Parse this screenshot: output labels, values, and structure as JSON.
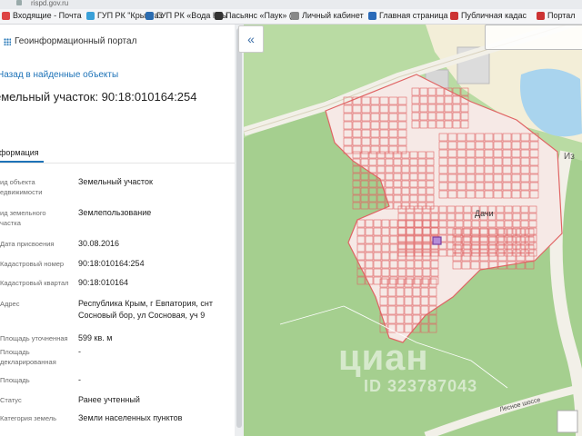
{
  "address_bar": {
    "url": "rispd.gov.ru"
  },
  "bookmarks": [
    {
      "label": "Входящие - Почта",
      "color": "#d44"
    },
    {
      "label": "ГУП РК \"Крымгаз",
      "color": "#3aa0d8"
    },
    {
      "label": "ГУП РК «Вода Кры",
      "color": "#2b6cb0"
    },
    {
      "label": "Пасьянс «Паук» (",
      "color": "#333"
    },
    {
      "label": "Личный кабинет",
      "color": "#888"
    },
    {
      "label": "Главная страница",
      "color": "#2a6ab8"
    },
    {
      "label": "Публичная кадас",
      "color": "#c33"
    },
    {
      "label": "Портал",
      "color": "#c33"
    }
  ],
  "panel": {
    "portal_title": "Геоинформационный портал",
    "back_link": "Назад в найденные объекты",
    "object_title": "емельный участок: 90:18:010164:254",
    "tab_info": "нформация",
    "rows": [
      {
        "label": "ид объекта\nедвижимости",
        "value": "Земельный участок"
      },
      {
        "label": "ид земельного\nчастка",
        "value": "Землепользование"
      },
      {
        "label": "Дата присвоения",
        "value": "30.08.2016"
      },
      {
        "label": "Кадастровый номер",
        "value": "90:18:010164:254"
      },
      {
        "label": "Кадастровый квартал",
        "value": "90:18:010164"
      },
      {
        "label": "Адрес",
        "value": "Республика Крым, г Евпатория, снт\nСосновый бор, ул Сосновая, уч 9"
      },
      {
        "label": "Площадь уточненная",
        "value": "599 кв. м"
      },
      {
        "label": "Площадь\nдекларированная",
        "value": "-"
      },
      {
        "label": "Площадь",
        "value": "-"
      },
      {
        "label": "Статус",
        "value": "Ранее учтенный"
      },
      {
        "label": "Категория земель",
        "value": "Земли населенных пунктов"
      }
    ]
  },
  "map": {
    "label_dachi": "Дачи",
    "label_road": "Лесное шоссе",
    "label_edge": "Из",
    "watermark": "циан",
    "watermark_id": "ID 323787043",
    "colors": {
      "green": "#9cc88a",
      "road": "#f2f0e8",
      "parcel": "#e06464",
      "water": "#a9d4ee",
      "sand": "#f3eed8"
    }
  }
}
